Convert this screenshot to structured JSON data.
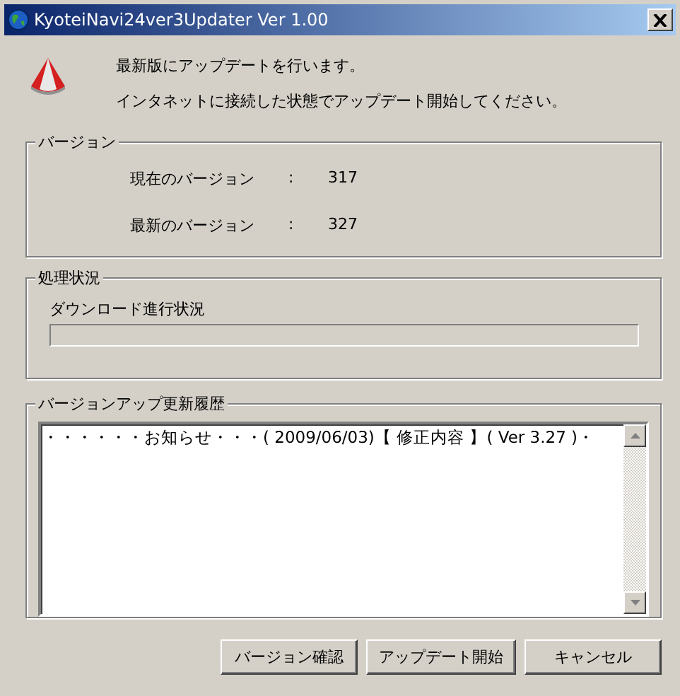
{
  "window": {
    "title": "KyoteiNavi24ver3Updater Ver 1.00"
  },
  "messages": [
    "最新版にアップデートを行います。",
    "インタネットに接続した状態でアップデート開始してください。"
  ],
  "version_group": {
    "title": "バージョン",
    "rows": [
      {
        "label": "現在のバージョン",
        "separator": ":",
        "value": "317"
      },
      {
        "label": "最新のバージョン",
        "separator": ":",
        "value": "327"
      }
    ]
  },
  "progress_group": {
    "title": "処理状況",
    "label": "ダウンロード進行状況",
    "level": 0
  },
  "history_group": {
    "title": "バージョンアップ更新履歴",
    "text": "・・・・・・お知らせ・・・( 2009/06/03)【 修正内容 】( Ver 3.27 )・"
  },
  "buttons": [
    "バージョン確認",
    "アップデート開始",
    "キャンセル"
  ]
}
